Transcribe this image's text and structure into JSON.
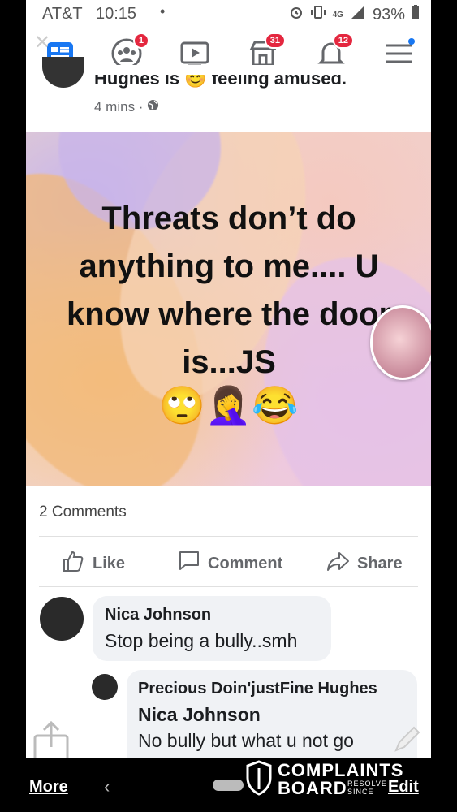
{
  "status_bar": {
    "carrier": "AT&T",
    "time": "10:15",
    "dot": "•",
    "network": "4G",
    "battery": "93%"
  },
  "nav": {
    "items": [
      {
        "icon": "news-feed-icon",
        "badge": ""
      },
      {
        "icon": "groups-icon",
        "badge": "1"
      },
      {
        "icon": "watch-icon",
        "badge": ""
      },
      {
        "icon": "marketplace-icon",
        "badge": "31"
      },
      {
        "icon": "notifications-icon",
        "badge": "12"
      },
      {
        "icon": "menu-icon",
        "badge": ""
      }
    ]
  },
  "post": {
    "author_partial": "Hughes is 😊 feeling amused.",
    "time": "4 mins · ",
    "image_text": "Threats don’t do anything to me.... U know where the door is...JS",
    "image_emoji": "🙄🤦‍♀️😂",
    "comments_count": "2 Comments",
    "actions": {
      "like": "Like",
      "comment": "Comment",
      "share": "Share"
    }
  },
  "comments": [
    {
      "name": "Nica Johnson",
      "text": "Stop being a bully..smh"
    },
    {
      "name": "Precious Doin'justFine Hughes",
      "mention": "Nica Johnson",
      "text": "No bully but what u not go"
    }
  ],
  "bottom_bar": {
    "more": "More",
    "edit": "Edit",
    "watermark_line1": "COMPLAINTS",
    "watermark_line2": "BOARD",
    "watermark_small": "RESOLVE SINCE"
  },
  "colors": {
    "fb_blue": "#1877f2",
    "badge_red": "#e4273f",
    "text_gray": "#65676b"
  }
}
